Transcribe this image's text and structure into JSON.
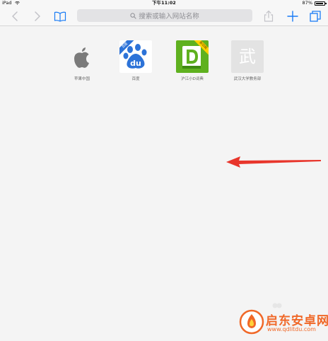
{
  "status_bar": {
    "device": "iPad",
    "time": "下午11:02",
    "battery": "87%"
  },
  "toolbar": {
    "address_placeholder": "搜索或输入网站名称"
  },
  "favorites": [
    {
      "label": "苹果中国",
      "icon": "apple-icon"
    },
    {
      "label": "百度",
      "icon": "baidu-paw-icon",
      "ribbon": "百度"
    },
    {
      "label": "沪江小D词典",
      "icon": "hujiang-d-icon",
      "ribbon": "新功能"
    },
    {
      "label": "武汉大学教务部",
      "icon": "whu-text-icon",
      "icon_text": "武"
    }
  ],
  "watermark": {
    "title": "启东安卓网",
    "url": "www.qdlitdu.com"
  },
  "colors": {
    "accent": "#1a7cf5",
    "arrow": "#e8352b",
    "watermark": "#f06828"
  }
}
